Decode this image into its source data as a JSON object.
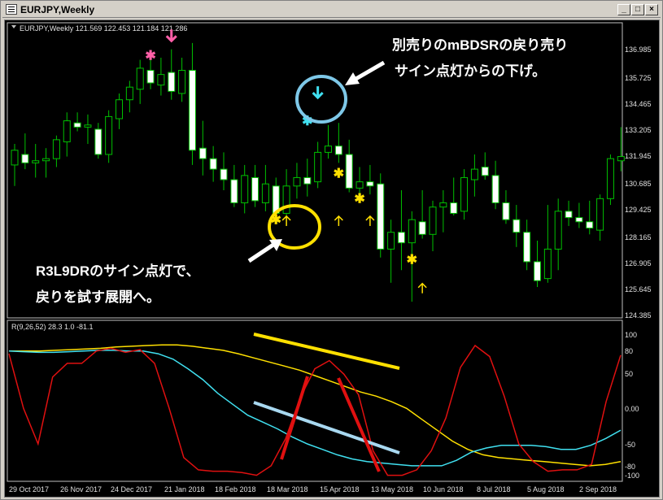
{
  "window": {
    "title": "EURJPY,Weekly",
    "buttons": [
      "minimize",
      "maximize",
      "close"
    ]
  },
  "main_chart": {
    "header": "EURJPY,Weekly  121.569 122.453 121.184 121.286",
    "price_labels": [
      "136.985",
      "135.725",
      "134.465",
      "133.205",
      "131.945",
      "130.685",
      "129.425",
      "128.165",
      "126.905",
      "125.645",
      "124.385"
    ]
  },
  "indicator": {
    "header": "R(9,26,52) 28.3 1.0 -81.1",
    "labels": [
      "100",
      "80",
      "50",
      "0.00",
      "-50",
      "-80",
      "-100"
    ]
  },
  "x_axis_labels": [
    "29 Oct 2017",
    "26 Nov 2017",
    "24 Dec 2017",
    "21 Jan 2018",
    "18 Feb 2018",
    "18 Mar 2018",
    "15 Apr 2018",
    "13 May 2018",
    "10 Jun 2018",
    "8 Jul 2018",
    "5 Aug 2018",
    "2 Sep 2018"
  ],
  "annotations": {
    "top_right_line1": "別売りのmBDSRの戻り売り",
    "top_right_line2": "サイン点灯からの下げ。",
    "bottom_left_line1": "R3L9DRのサイン点灯で、",
    "bottom_left_line2": "戻りを試す展開へ。"
  },
  "colors": {
    "background": "#000000",
    "bull_candle": "#ffffff",
    "bear_candle": "#000000",
    "wick": "#00c000",
    "yellow_line": "#ffe000",
    "cyan_line": "#40e0f0",
    "red_line": "#e01010",
    "circle_blue": "#7ec8e8",
    "circle_yellow": "#ffe000"
  },
  "chart_data": {
    "type": "candlestick",
    "price_range": [
      124.385,
      136.985
    ],
    "candles": [
      {
        "o": 131.5,
        "h": 132.5,
        "l": 130.5,
        "c": 132.2
      },
      {
        "o": 132.0,
        "h": 133.0,
        "l": 131.3,
        "c": 131.6
      },
      {
        "o": 131.6,
        "h": 132.5,
        "l": 130.9,
        "c": 131.7
      },
      {
        "o": 131.7,
        "h": 132.3,
        "l": 130.9,
        "c": 131.8
      },
      {
        "o": 131.8,
        "h": 132.9,
        "l": 131.4,
        "c": 132.7
      },
      {
        "o": 132.6,
        "h": 134.0,
        "l": 131.9,
        "c": 133.6
      },
      {
        "o": 133.5,
        "h": 134.0,
        "l": 133.1,
        "c": 133.3
      },
      {
        "o": 133.3,
        "h": 133.9,
        "l": 132.5,
        "c": 133.4
      },
      {
        "o": 133.2,
        "h": 133.5,
        "l": 131.8,
        "c": 132.0
      },
      {
        "o": 132.0,
        "h": 134.1,
        "l": 131.6,
        "c": 133.8
      },
      {
        "o": 133.7,
        "h": 134.9,
        "l": 133.2,
        "c": 134.6
      },
      {
        "o": 134.6,
        "h": 135.5,
        "l": 134.0,
        "c": 135.2
      },
      {
        "o": 135.1,
        "h": 136.5,
        "l": 134.4,
        "c": 136.1
      },
      {
        "o": 136.0,
        "h": 136.6,
        "l": 135.1,
        "c": 135.4
      },
      {
        "o": 135.3,
        "h": 136.6,
        "l": 134.8,
        "c": 135.8
      },
      {
        "o": 135.9,
        "h": 137.0,
        "l": 134.6,
        "c": 135.0
      },
      {
        "o": 134.9,
        "h": 136.6,
        "l": 134.5,
        "c": 136.0
      },
      {
        "o": 136.0,
        "h": 137.3,
        "l": 131.5,
        "c": 132.2
      },
      {
        "o": 132.3,
        "h": 133.6,
        "l": 131.0,
        "c": 131.8
      },
      {
        "o": 131.8,
        "h": 132.4,
        "l": 130.7,
        "c": 131.3
      },
      {
        "o": 131.3,
        "h": 132.1,
        "l": 130.3,
        "c": 130.8
      },
      {
        "o": 130.8,
        "h": 131.5,
        "l": 129.5,
        "c": 129.7
      },
      {
        "o": 129.7,
        "h": 131.5,
        "l": 129.2,
        "c": 131.0
      },
      {
        "o": 130.9,
        "h": 131.5,
        "l": 129.5,
        "c": 129.8
      },
      {
        "o": 129.7,
        "h": 131.5,
        "l": 129.3,
        "c": 130.6
      },
      {
        "o": 130.5,
        "h": 130.9,
        "l": 128.9,
        "c": 129.2
      },
      {
        "o": 129.2,
        "h": 131.3,
        "l": 128.6,
        "c": 130.5
      },
      {
        "o": 130.5,
        "h": 131.6,
        "l": 129.9,
        "c": 130.9
      },
      {
        "o": 130.9,
        "h": 131.8,
        "l": 130.0,
        "c": 130.6
      },
      {
        "o": 130.7,
        "h": 132.6,
        "l": 130.4,
        "c": 132.1
      },
      {
        "o": 132.1,
        "h": 133.4,
        "l": 131.8,
        "c": 132.4
      },
      {
        "o": 132.4,
        "h": 133.5,
        "l": 131.6,
        "c": 132.0
      },
      {
        "o": 132.0,
        "h": 132.7,
        "l": 130.2,
        "c": 130.4
      },
      {
        "o": 130.4,
        "h": 131.4,
        "l": 129.8,
        "c": 130.7
      },
      {
        "o": 130.7,
        "h": 131.5,
        "l": 130.1,
        "c": 130.5
      },
      {
        "o": 130.6,
        "h": 131.1,
        "l": 127.1,
        "c": 127.5
      },
      {
        "o": 127.5,
        "h": 128.9,
        "l": 125.9,
        "c": 128.3
      },
      {
        "o": 128.3,
        "h": 130.3,
        "l": 126.5,
        "c": 127.8
      },
      {
        "o": 127.8,
        "h": 129.3,
        "l": 125.0,
        "c": 128.9
      },
      {
        "o": 128.8,
        "h": 130.3,
        "l": 128.0,
        "c": 128.2
      },
      {
        "o": 128.2,
        "h": 129.8,
        "l": 127.4,
        "c": 129.5
      },
      {
        "o": 129.5,
        "h": 130.3,
        "l": 128.3,
        "c": 129.7
      },
      {
        "o": 129.7,
        "h": 130.9,
        "l": 129.1,
        "c": 129.2
      },
      {
        "o": 129.3,
        "h": 131.3,
        "l": 128.9,
        "c": 130.9
      },
      {
        "o": 130.8,
        "h": 132.0,
        "l": 130.0,
        "c": 131.3
      },
      {
        "o": 131.4,
        "h": 132.1,
        "l": 130.8,
        "c": 131.0
      },
      {
        "o": 131.0,
        "h": 131.7,
        "l": 129.4,
        "c": 129.7
      },
      {
        "o": 129.7,
        "h": 130.3,
        "l": 128.7,
        "c": 128.9
      },
      {
        "o": 128.9,
        "h": 129.6,
        "l": 127.6,
        "c": 128.3
      },
      {
        "o": 128.3,
        "h": 128.9,
        "l": 126.5,
        "c": 126.9
      },
      {
        "o": 126.9,
        "h": 127.9,
        "l": 125.7,
        "c": 126.0
      },
      {
        "o": 126.1,
        "h": 129.6,
        "l": 125.9,
        "c": 127.5
      },
      {
        "o": 127.5,
        "h": 129.9,
        "l": 126.5,
        "c": 129.3
      },
      {
        "o": 129.3,
        "h": 129.8,
        "l": 128.6,
        "c": 129.0
      },
      {
        "o": 129.0,
        "h": 129.7,
        "l": 128.5,
        "c": 128.8
      },
      {
        "o": 128.8,
        "h": 129.8,
        "l": 128.2,
        "c": 128.5
      },
      {
        "o": 128.4,
        "h": 130.1,
        "l": 127.9,
        "c": 129.9
      },
      {
        "o": 129.9,
        "h": 132.0,
        "l": 129.6,
        "c": 131.8
      },
      {
        "o": 131.7,
        "h": 133.3,
        "l": 131.2,
        "c": 131.9
      }
    ],
    "markers": [
      {
        "kind": "star",
        "color": "#ff5fa8",
        "x_index": 13,
        "price": 136.5
      },
      {
        "kind": "arrow_down",
        "color": "#ff5fa8",
        "x_index": 15,
        "price": 137.4
      },
      {
        "kind": "star",
        "color": "#40e0f0",
        "x_index": 28,
        "price": 133.4
      },
      {
        "kind": "arrow_down",
        "color": "#40e0f0",
        "x_index": 29,
        "price": 134.7
      },
      {
        "kind": "star",
        "color": "#ffe000",
        "x_index": 31,
        "price": 130.9
      },
      {
        "kind": "star",
        "color": "#ffe000",
        "x_index": 25,
        "price": 128.7
      },
      {
        "kind": "arrow_up",
        "color": "#ffe000",
        "x_index": 26,
        "price": 128.6
      },
      {
        "kind": "arrow_up",
        "color": "#ffe000",
        "x_index": 31,
        "price": 128.6
      },
      {
        "kind": "star",
        "color": "#ffe000",
        "x_index": 33,
        "price": 129.7
      },
      {
        "kind": "arrow_up",
        "color": "#ffe000",
        "x_index": 34,
        "price": 128.6
      },
      {
        "kind": "star",
        "color": "#ffe000",
        "x_index": 38,
        "price": 126.8
      },
      {
        "kind": "arrow_up",
        "color": "#ffe000",
        "x_index": 39,
        "price": 125.4
      }
    ],
    "indicator_series": [
      {
        "color": "#ffe000",
        "values": [
          86,
          86,
          86,
          87,
          88,
          89,
          90,
          92,
          93,
          94,
          95,
          95,
          93,
          90,
          87,
          82,
          76,
          70,
          64,
          58,
          50,
          42,
          34,
          26,
          20,
          12,
          2,
          -14,
          -30,
          -46,
          -58,
          -66,
          -70,
          -72,
          -74,
          -76,
          -78,
          -80,
          -82,
          -80,
          -76
        ]
      },
      {
        "color": "#40e0f0",
        "values": [
          86,
          85,
          84,
          84,
          85,
          86,
          87,
          87,
          86,
          86,
          82,
          74,
          60,
          44,
          24,
          8,
          -8,
          -18,
          -28,
          -40,
          -50,
          -58,
          -66,
          -72,
          -76,
          -78,
          -80,
          -82,
          -82,
          -82,
          -74,
          -62,
          -56,
          -52,
          -52,
          -52,
          -54,
          -58,
          -58,
          -52,
          -42,
          -30
        ]
      },
      {
        "color": "#e01010",
        "values": [
          82,
          2,
          -50,
          48,
          68,
          68,
          86,
          90,
          84,
          88,
          68,
          2,
          -70,
          -88,
          -90,
          -90,
          -92,
          -96,
          -82,
          -42,
          18,
          60,
          72,
          52,
          22,
          -60,
          -96,
          -96,
          -88,
          -60,
          -12,
          62,
          94,
          78,
          20,
          -50,
          -76,
          -90,
          -88,
          -88,
          -80,
          12,
          80
        ]
      }
    ]
  }
}
